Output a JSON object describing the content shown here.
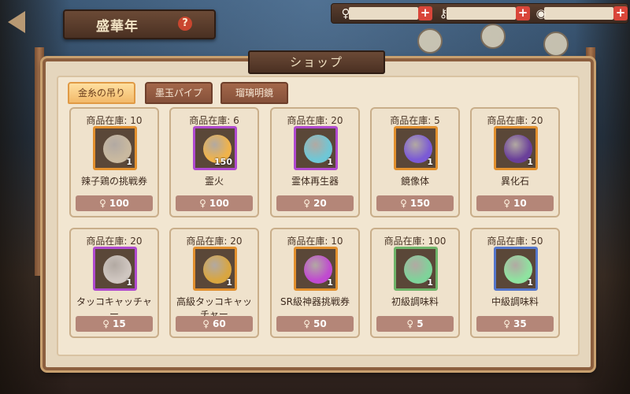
{
  "title": "盛華年",
  "help_symbol": "?",
  "resources": [
    {
      "icon": "key-icon",
      "plus": "+"
    },
    {
      "icon": "wand-icon",
      "plus": "+"
    },
    {
      "icon": "orb-icon",
      "plus": "+"
    }
  ],
  "shop": {
    "title": "ショップ",
    "tabs": [
      "金糸の吊り",
      "墨玉パイプ",
      "瑠璃明鏡"
    ],
    "active_tab": 0,
    "items": [
      {
        "stock": "商品在庫: 10",
        "name": "辣子鶏の挑戦券",
        "qty": "1",
        "price": "100",
        "rarity": "orange",
        "icon": "ticket-icon"
      },
      {
        "stock": "商品在庫: 6",
        "name": "霊火",
        "qty": "150",
        "price": "100",
        "rarity": "purple",
        "icon": "flame-icon"
      },
      {
        "stock": "商品在庫: 20",
        "name": "霊体再生器",
        "qty": "1",
        "price": "20",
        "rarity": "purple",
        "icon": "crystal-icon"
      },
      {
        "stock": "商品在庫: 5",
        "name": "鏡像体",
        "qty": "1",
        "price": "150",
        "rarity": "orange",
        "icon": "slime-icon"
      },
      {
        "stock": "商品在庫: 20",
        "name": "異化石",
        "qty": "1",
        "price": "10",
        "rarity": "orange",
        "icon": "stone-icon"
      },
      {
        "stock": "商品在庫: 20",
        "name": "タッコキャッチャー",
        "qty": "1",
        "price": "15",
        "rarity": "purple",
        "icon": "claw-icon"
      },
      {
        "stock": "商品在庫: 20",
        "name": "高級タッコキャッチャー",
        "qty": "1",
        "price": "60",
        "rarity": "orange",
        "icon": "gold-claw-icon"
      },
      {
        "stock": "商品在庫: 10",
        "name": "SR級神器挑戦券",
        "qty": "1",
        "price": "50",
        "rarity": "orange",
        "icon": "puzzle-icon"
      },
      {
        "stock": "商品在庫: 100",
        "name": "初級調味料",
        "qty": "1",
        "price": "5",
        "rarity": "green",
        "icon": "leaf-icon"
      },
      {
        "stock": "商品在庫: 50",
        "name": "中級調味料",
        "qty": "1",
        "price": "35",
        "rarity": "blue",
        "icon": "leaf-sparkle-icon"
      }
    ]
  },
  "currency_icon": "key-icon",
  "colors": {
    "purple": "#b04ad0",
    "orange": "#e2902e",
    "green": "#6fb56a",
    "blue": "#5577cc",
    "price_bg": "#b48678"
  }
}
